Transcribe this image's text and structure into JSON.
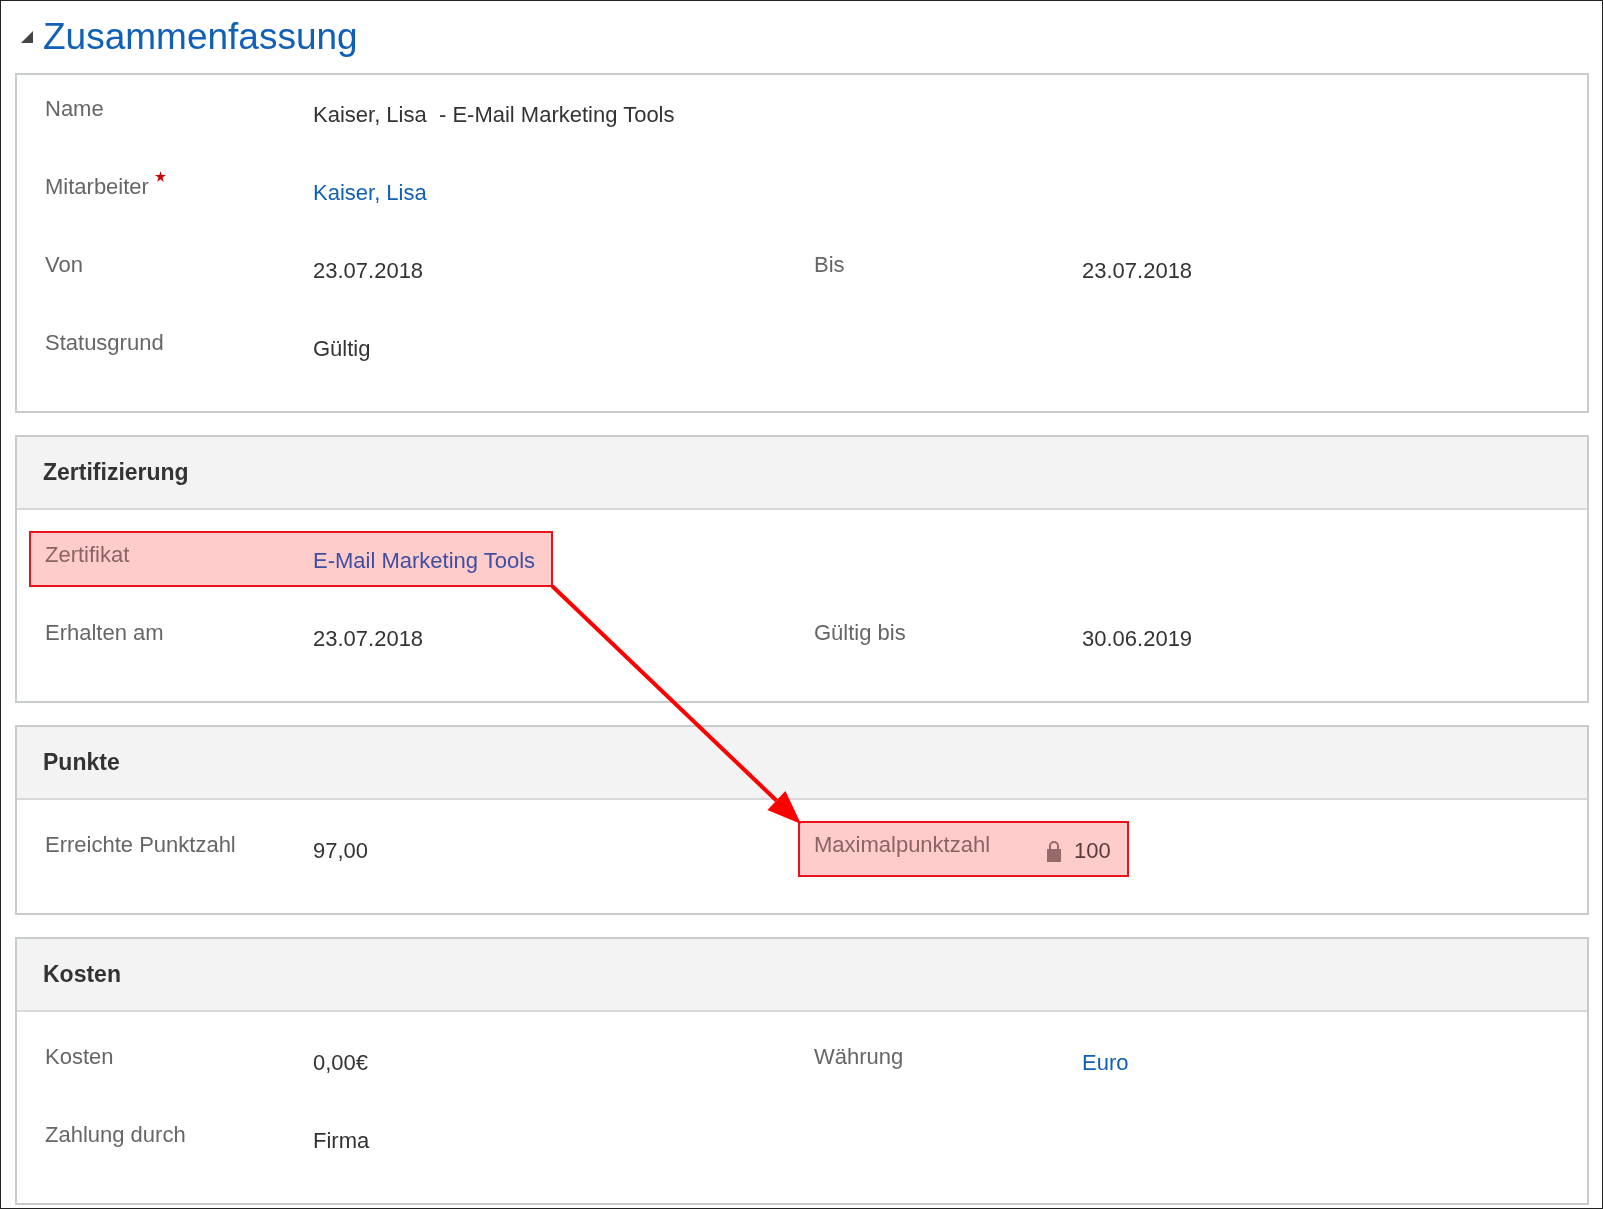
{
  "title": "Zusammenfassung",
  "expanded": true,
  "sections": [
    {
      "rows": [
        [
          {
            "label": "Name",
            "value": "Kaiser, Lisa  - E-Mail Marketing Tools",
            "kind": "text"
          }
        ],
        [
          {
            "label": "Mitarbeiter",
            "value": "Kaiser, Lisa",
            "kind": "link",
            "required": true
          }
        ],
        [
          {
            "label": "Von",
            "value": "23.07.2018",
            "kind": "text"
          },
          {
            "label": "Bis",
            "value": "23.07.2018",
            "kind": "text"
          }
        ],
        [
          {
            "label": "Statusgrund",
            "value": "Gültig",
            "kind": "text"
          }
        ]
      ]
    },
    {
      "header": "Zertifizierung",
      "rows": [
        [
          {
            "label": "Zertifikat",
            "value": "E-Mail Marketing Tools",
            "kind": "link",
            "highlighted": true
          }
        ],
        [
          {
            "label": "Erhalten am",
            "value": "23.07.2018",
            "kind": "text"
          },
          {
            "label": "Gültig bis",
            "value": "30.06.2019",
            "kind": "text"
          }
        ]
      ]
    },
    {
      "header": "Punkte",
      "rows": [
        [
          {
            "label": "Erreichte Punktzahl",
            "value": "97,00",
            "kind": "text"
          },
          {
            "label": "Maximalpunktzahl",
            "value": "100",
            "kind": "text",
            "locked": true,
            "highlighted": true
          }
        ]
      ]
    },
    {
      "header": "Kosten",
      "rows": [
        [
          {
            "label": "Kosten",
            "value": "0,00€",
            "kind": "text"
          },
          {
            "label": "Währung",
            "value": "Euro",
            "kind": "link"
          }
        ],
        [
          {
            "label": "Zahlung durch",
            "value": "Firma",
            "kind": "text"
          }
        ]
      ]
    }
  ]
}
